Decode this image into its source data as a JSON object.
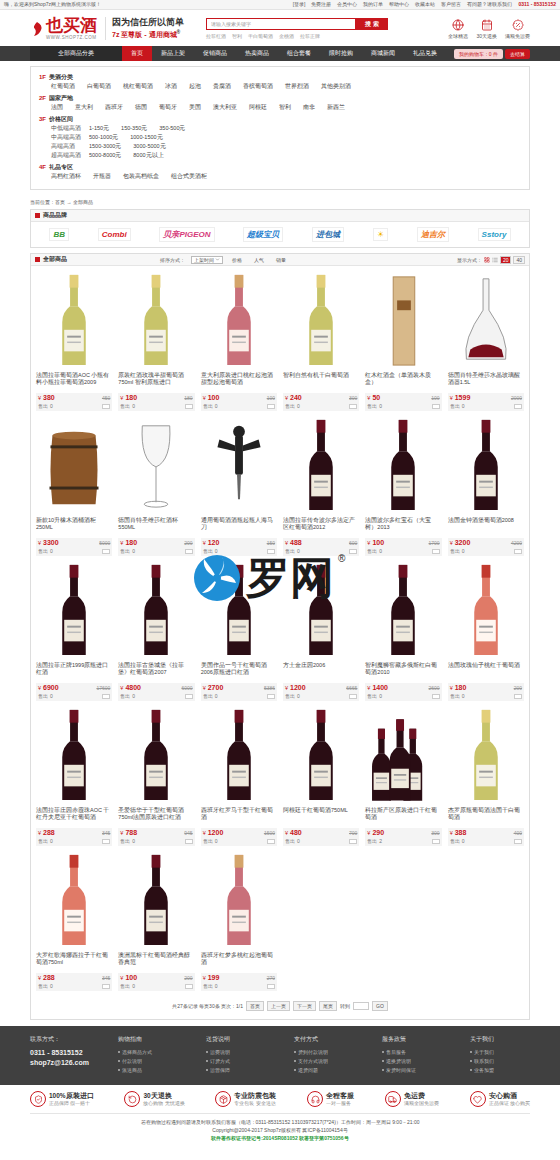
{
  "topbar": {
    "welcome": "嗨，欢迎来到Shop7z网上购物系统演示版！",
    "links": [
      "[登录]",
      "免费注册",
      "会员中心",
      "我的订单",
      "帮助中心",
      "收藏本站",
      "客户留言",
      "有问题？请联系我们"
    ],
    "phone": "0311 - 85315152"
  },
  "header": {
    "logo": {
      "name": "也买酒",
      "url": "WWW.SHOP7Z.COM"
    },
    "slogan": {
      "line1": "因为信任所以简单",
      "line2": "7z 至尊版 - 通用商城",
      "mark": "®"
    },
    "search": {
      "placeholder": "请输入搜索关键字",
      "button": "搜 索"
    },
    "hot_keywords": [
      "拉菲红酒",
      "智利",
      "干白葡萄酒",
      "金桃酒",
      "拉菲正牌"
    ],
    "badges": [
      {
        "label": "全球精选"
      },
      {
        "label": "30天退换"
      },
      {
        "label": "满额免运费"
      }
    ]
  },
  "nav": {
    "category_button": "全部商品分类",
    "items": [
      {
        "label": "首页",
        "selected": true
      },
      {
        "label": "新品上架",
        "selected": false
      },
      {
        "label": "促销商品",
        "selected": false
      },
      {
        "label": "热卖商品",
        "selected": false
      },
      {
        "label": "组合套餐",
        "selected": false
      },
      {
        "label": "限时抢购",
        "selected": false
      },
      {
        "label": "商城新闻",
        "selected": false
      },
      {
        "label": "礼品兑换",
        "selected": false
      }
    ],
    "cart": "我的购物车：0 件",
    "checkout": "去结算"
  },
  "categories": [
    {
      "floor": "1F",
      "title": "美酒分类",
      "rows": [
        {
          "links": [
            "红葡萄酒",
            "白葡萄酒",
            "桃红葡萄酒",
            "冰酒",
            "起泡",
            "贵腐酒",
            "香槟葡萄酒",
            "世界烈酒",
            "其他类别酒"
          ]
        }
      ]
    },
    {
      "floor": "2F",
      "title": "国家产地",
      "rows": [
        {
          "links": [
            "法国",
            "意大利",
            "西班牙",
            "德国",
            "葡萄牙",
            "美国",
            "澳大利亚",
            "阿根廷",
            "智利",
            "南非",
            "新西兰"
          ]
        }
      ]
    },
    {
      "floor": "3F",
      "title": "价格区间",
      "rows": [
        {
          "label": "中低端高酒",
          "links": [
            "1-150元",
            "150-350元",
            "350-500元"
          ]
        },
        {
          "label": "中高端高酒",
          "links": [
            "500-1000元",
            "1000-1500元"
          ]
        },
        {
          "label": "高端高酒",
          "links": [
            "1500-3000元",
            "3000-5000元"
          ]
        },
        {
          "label": "超高端高酒",
          "links": [
            "5000-8000元",
            "8000元以上"
          ]
        }
      ]
    },
    {
      "floor": "4F",
      "title": "礼品专区",
      "rows": [
        {
          "links": [
            "高档红酒杯",
            "开瓶器",
            "包装高档纸盒",
            "组合式美酒柜"
          ]
        }
      ]
    }
  ],
  "breadcrumb": "当前位置：首页 → 全部商品",
  "brands": {
    "title": "商品品牌",
    "items": [
      {
        "label": "BB",
        "color": "#3a9a3a"
      },
      {
        "label": "Combi",
        "color": "#d8232a"
      },
      {
        "label": "贝亲PIGEON",
        "color": "#d63a7a"
      },
      {
        "label": "超级宝贝",
        "color": "#1f7fd0"
      },
      {
        "label": "进包城",
        "color": "#2a6fb0"
      },
      {
        "label": "☀",
        "color": "#f2b705"
      },
      {
        "label": "迪吉尔",
        "color": "#f07a1a"
      },
      {
        "label": "Sstory",
        "color": "#2aa0c8"
      }
    ]
  },
  "listing": {
    "title": "全部商品",
    "sort_label": "排序方式：",
    "sorts": [
      {
        "label": "上架时间",
        "selected": true
      },
      {
        "label": "价格",
        "selected": false
      },
      {
        "label": "人气",
        "selected": false
      },
      {
        "label": "销量",
        "selected": false
      }
    ],
    "display_label": "显示方式：",
    "per_page": [
      {
        "label": "20",
        "selected": true
      },
      {
        "label": "40",
        "selected": false
      }
    ]
  },
  "currency": "¥",
  "sold_label": "售出",
  "products": [
    {
      "name": "法国拉菲葡萄酒AOC 小瓶有料小瓶拉菲葡萄酒2009",
      "price": "380",
      "old_price": "450",
      "sold": "0",
      "kind": "white-wine"
    },
    {
      "name": "原装红酒玫瑰半甜葡萄酒750ml 智利原瓶进口",
      "price": "180",
      "old_price": "180",
      "sold": "0",
      "kind": "white-wine"
    },
    {
      "name": "意大利原装进口桃红起泡酒甜型起泡葡萄酒",
      "price": "100",
      "old_price": "100",
      "sold": "0",
      "kind": "sparkling"
    },
    {
      "name": "智利自然有机干白葡萄酒",
      "price": "240",
      "old_price": "300",
      "sold": "0",
      "kind": "white-wine"
    },
    {
      "name": "红木红酒盒（单酒装木质盒）",
      "price": "50",
      "old_price": "100",
      "sold": "0",
      "kind": "wood-box"
    },
    {
      "name": "德国肖特圣维莎水晶玻璃醒酒器1.5L",
      "price": "1599",
      "old_price": "2000",
      "sold": "0",
      "kind": "decanter"
    },
    {
      "name": "新款10升橡木酒桶酒柜 250ML",
      "price": "3300",
      "old_price": "5000",
      "sold": "0",
      "kind": "barrel"
    },
    {
      "name": "德国肖特圣维莎红酒杯550ML",
      "price": "180",
      "old_price": "200",
      "sold": "0",
      "kind": "glass"
    },
    {
      "name": "通用葡萄酒酒瓶起瓶人海马刀",
      "price": "120",
      "old_price": "150",
      "sold": "0",
      "kind": "opener"
    },
    {
      "name": "法国拉菲传奇波尔多法定产区红葡萄酒2012",
      "price": "488",
      "old_price": "600",
      "sold": "0",
      "kind": "red-wine"
    },
    {
      "name": "法国波尔多红宝石（大宝树）2013",
      "price": "100",
      "old_price": "1700",
      "sold": "0",
      "kind": "red-wine"
    },
    {
      "name": "法国金钟酒堡葡萄酒2008",
      "price": "3200",
      "old_price": "4200",
      "sold": "0",
      "kind": "red-wine"
    },
    {
      "name": "法国拉菲正牌1999原瓶进口红酒",
      "price": "6900",
      "old_price": "17600",
      "sold": "0",
      "kind": "red-wine"
    },
    {
      "name": "法国拉菲古堡城堡《拉菲堡》红葡萄酒2007",
      "price": "4800",
      "old_price": "6000",
      "sold": "0",
      "kind": "red-wine"
    },
    {
      "name": "美国作品一号干红葡萄酒2006原瓶进口红酒",
      "price": "2700",
      "old_price": "5386",
      "sold": "0",
      "kind": "red-wine"
    },
    {
      "name": "方士金庄园2006",
      "price": "1200",
      "old_price": "6665",
      "sold": "0",
      "kind": "red-wine"
    },
    {
      "name": "智利魔狮窖藏多俄斯红白葡萄酒2010",
      "price": "1400",
      "old_price": "2600",
      "sold": "0",
      "kind": "red-wine"
    },
    {
      "name": "法国玫瑰仙子桃红干葡萄酒",
      "price": "180",
      "old_price": "200",
      "sold": "0",
      "kind": "rose-wine"
    },
    {
      "name": "法国拉菲庄园赤霞珠AOC 干红丹夫尼亚干红葡萄酒",
      "price": "288",
      "old_price": "345",
      "sold": "0",
      "kind": "red-wine"
    },
    {
      "name": "圣爱德华于干型红葡萄酒750ml法国原装进口红酒",
      "price": "788",
      "old_price": "945",
      "sold": "0",
      "kind": "red-wine"
    },
    {
      "name": "西班牙红罗马干型干红葡萄酒",
      "price": "1200",
      "old_price": "1500",
      "sold": "0",
      "kind": "red-wine"
    },
    {
      "name": "阿根廷干红葡萄酒750ML",
      "price": "480",
      "old_price": "700",
      "sold": "0",
      "kind": "red-wine"
    },
    {
      "name": "科拉斯产区原装进口干红葡萄酒",
      "price": "290",
      "old_price": "300",
      "sold": "2",
      "kind": "bottle-set"
    },
    {
      "name": "杰罗原瓶葡萄酒法国干白葡萄酒",
      "price": "388",
      "old_price": "400",
      "sold": "0",
      "kind": "white-wine"
    },
    {
      "name": "大罗红歌海娜西拉子干红葡萄酒750ml",
      "price": "288",
      "old_price": "345",
      "sold": "0",
      "kind": "rose-wine"
    },
    {
      "name": "澳洲黑标干红葡萄酒经典醇香典范",
      "price": "100",
      "old_price": "200",
      "sold": "0",
      "kind": "red-wine"
    },
    {
      "name": "西班牙红梦多桃红起泡葡萄酒",
      "price": "199",
      "old_price": "270",
      "sold": "0",
      "kind": "sparkling"
    }
  ],
  "pagination": {
    "summary": "共27条记录 每页30条 页次：1/1",
    "buttons": [
      "首页",
      "上一页",
      "下一页",
      "尾页"
    ],
    "goto_label": "转到",
    "go": "GO"
  },
  "footer": {
    "columns": [
      {
        "title": "联系方式：",
        "kind": "contact",
        "lines": [
          "0311 - 85315152",
          "shop7z@126.com"
        ]
      },
      {
        "title": "购物指南",
        "kind": "links",
        "lines": [
          "选择商品方式",
          "付款说明",
          "派送商品"
        ]
      },
      {
        "title": "送货说明",
        "kind": "links",
        "lines": [
          "运费说明",
          "订货方式",
          "运营保障"
        ]
      },
      {
        "title": "支付方式",
        "kind": "links",
        "lines": [
          "货到付款说明",
          "支付方式说明",
          "退货问题"
        ]
      },
      {
        "title": "服务政策",
        "kind": "links",
        "lines": [
          "售后服务",
          "退换货说明",
          "发货时间保证"
        ]
      },
      {
        "title": "关于我们",
        "kind": "links",
        "lines": [
          "关于我们",
          "联系我们",
          "业务加盟"
        ]
      }
    ]
  },
  "services": [
    {
      "title": "100%原装进口",
      "subtitle": "正品保障 假一赔十"
    },
    {
      "title": "30天退换",
      "subtitle": "放心购物 无忧退换"
    },
    {
      "title": "专业防震包装",
      "subtitle": "专业包装 安全送达"
    },
    {
      "title": "全程客服",
      "subtitle": "一对一服务"
    },
    {
      "title": "免运费",
      "subtitle": "满额全国免运费"
    },
    {
      "title": "安心购酒",
      "subtitle": "正品保证 放心购买"
    }
  ],
  "copyright": {
    "lines": [
      "若在购物过程遇到问题请及时联系我们客服（电话：0311-85315152 13103973217(7*24)）工作时间：周一至周日 9:00－21:00",
      "Copyright@2004-2017 Shop7z版权所有 冀ICP备11004154号"
    ],
    "license": "软件著作权证书登记号:2014SR081052 软著登字第0751056号"
  },
  "watermark": {
    "text": "罗网",
    "mark": "®"
  }
}
